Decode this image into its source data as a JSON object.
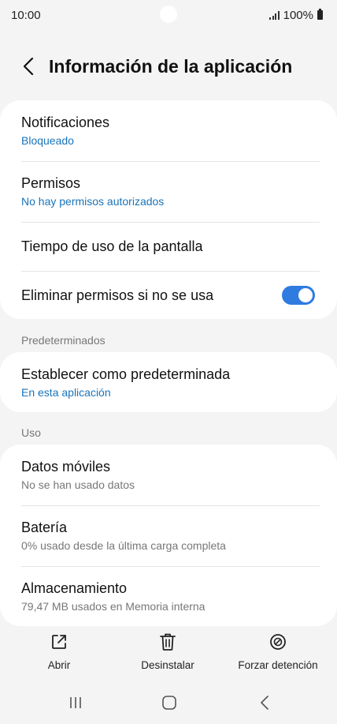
{
  "status_bar": {
    "time": "10:00",
    "battery": "100%"
  },
  "header": {
    "title": "Información de la aplicación"
  },
  "card1": {
    "items": [
      {
        "title": "Notificaciones",
        "subtitle": "Bloqueado"
      },
      {
        "title": "Permisos",
        "subtitle": "No hay permisos autorizados"
      },
      {
        "title": "Tiempo de uso de la pantalla"
      },
      {
        "title": "Eliminar permisos si no se usa",
        "toggle_on": true
      }
    ]
  },
  "section_defaults": {
    "label": "Predeterminados"
  },
  "card2": {
    "items": [
      {
        "title": "Establecer como predeterminada",
        "subtitle": "En esta aplicación"
      }
    ]
  },
  "section_usage": {
    "label": "Uso"
  },
  "card3": {
    "items": [
      {
        "title": "Datos móviles",
        "subtitle": "No se han usado datos"
      },
      {
        "title": "Batería",
        "subtitle": "0% usado desde la última carga completa"
      },
      {
        "title": "Almacenamiento",
        "subtitle": "79,47 MB usados en Memoria interna"
      }
    ]
  },
  "actions": {
    "open": "Abrir",
    "uninstall": "Desinstalar",
    "force_stop": "Forzar detención"
  },
  "colors": {
    "accent": "#2f7be0",
    "link": "#1a73b8",
    "background": "#f4f4f4"
  },
  "icons": {
    "back": "chevron-left-icon",
    "open": "open-external-icon",
    "uninstall": "trash-icon",
    "force_stop": "block-icon"
  }
}
